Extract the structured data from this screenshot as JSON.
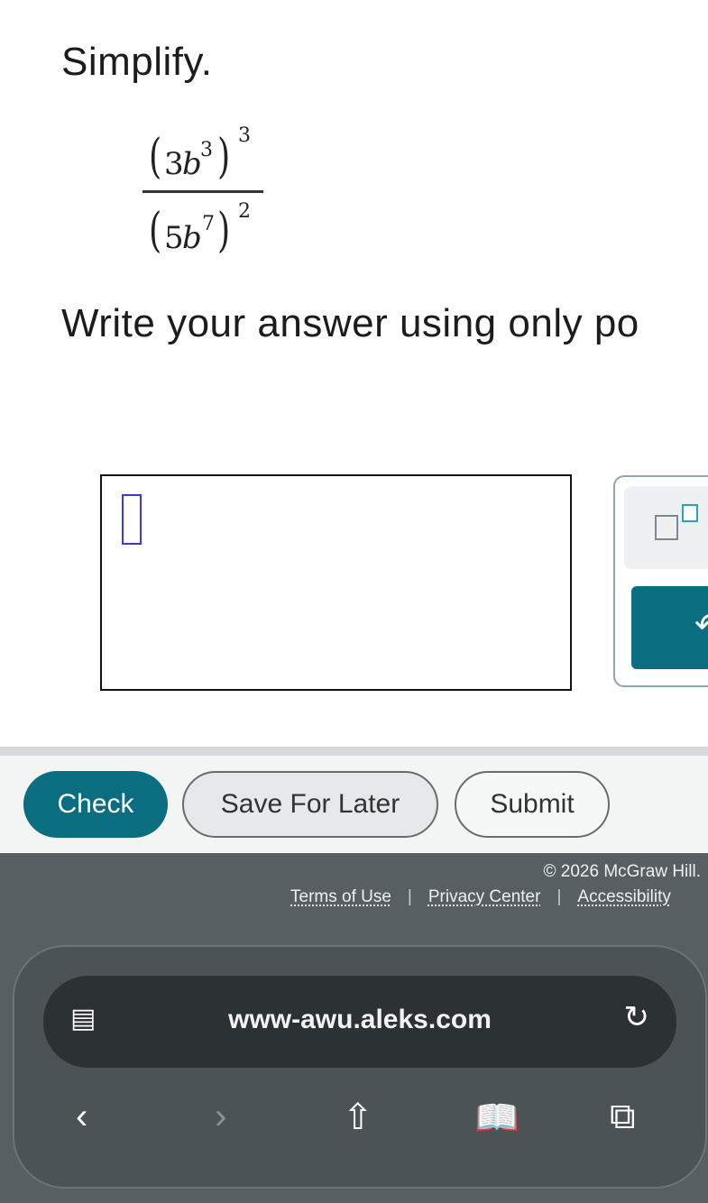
{
  "question": {
    "instruction": "Simplify.",
    "expression": {
      "numerator": {
        "coefficient": "3",
        "variable": "b",
        "inner_exponent": "3",
        "outer_exponent": "3"
      },
      "denominator": {
        "coefficient": "5",
        "variable": "b",
        "inner_exponent": "7",
        "outer_exponent": "2"
      }
    },
    "prompt": "Write your answer using only po"
  },
  "answer": {
    "value": ""
  },
  "toolbox": {
    "exponent_tool": "exponent-icon",
    "undo_tool": "undo-icon"
  },
  "actions": {
    "check": "Check",
    "save": "Save For Later",
    "submit": "Submit"
  },
  "footer": {
    "copyright": "© 2026 McGraw Hill.",
    "links": [
      "Terms of Use",
      "Privacy Center",
      "Accessibility"
    ]
  },
  "browser": {
    "url": "www-awu.aleks.com",
    "icons": [
      "tab-view-icon",
      "reload-icon",
      "back-icon",
      "forward-icon",
      "share-icon",
      "bookmarks-icon",
      "tabs-icon"
    ]
  },
  "colors": {
    "primary": "#0b6e80",
    "footer": "#585f62",
    "cursor": "#3a3ad6"
  }
}
